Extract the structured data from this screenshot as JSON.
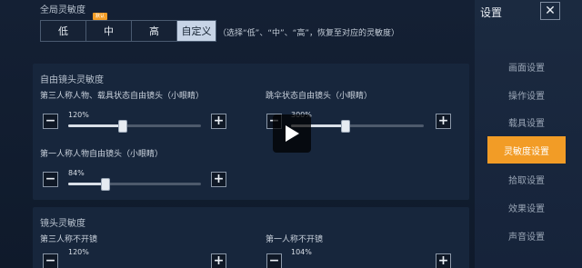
{
  "global_sensitivity": {
    "title": "全局灵敏度",
    "options": [
      "低",
      "中",
      "高",
      "自定义"
    ],
    "badge": "默认",
    "selected": "自定义",
    "hint": "（选择“低”、“中”、“高”，恢复至对应的灵敏度）"
  },
  "free_look": {
    "title": "自由镜头灵敏度",
    "third_person": {
      "label": "第三人称人物、载具状态自由镜头（小眼睛）",
      "value_text": "120%",
      "value": 1.2
    },
    "parachute": {
      "label": "跳伞状态自由镜头（小眼睛）",
      "value_text": "300%",
      "value": 3.0
    },
    "first_person": {
      "label": "第一人称人物自由镜头（小眼睛）",
      "value_text": "84%",
      "value": 0.84
    }
  },
  "camera_sensitivity": {
    "title": "镜头灵敏度",
    "third_no_scope": {
      "label": "第三人称不开镜",
      "value_text": "120%"
    },
    "first_no_scope": {
      "label": "第一人称不开镜",
      "value_text": "104%"
    }
  },
  "menu": {
    "title": "设置",
    "close_symbol": "✕",
    "items": [
      "画面设置",
      "操作设置",
      "载具设置",
      "灵敏度设置",
      "拾取设置",
      "效果设置",
      "声音设置"
    ],
    "active": "灵敏度设置"
  },
  "controls": {
    "minus": "−",
    "plus": "+"
  },
  "colors": {
    "accent": "#f29c26",
    "panel": "#17263c"
  }
}
